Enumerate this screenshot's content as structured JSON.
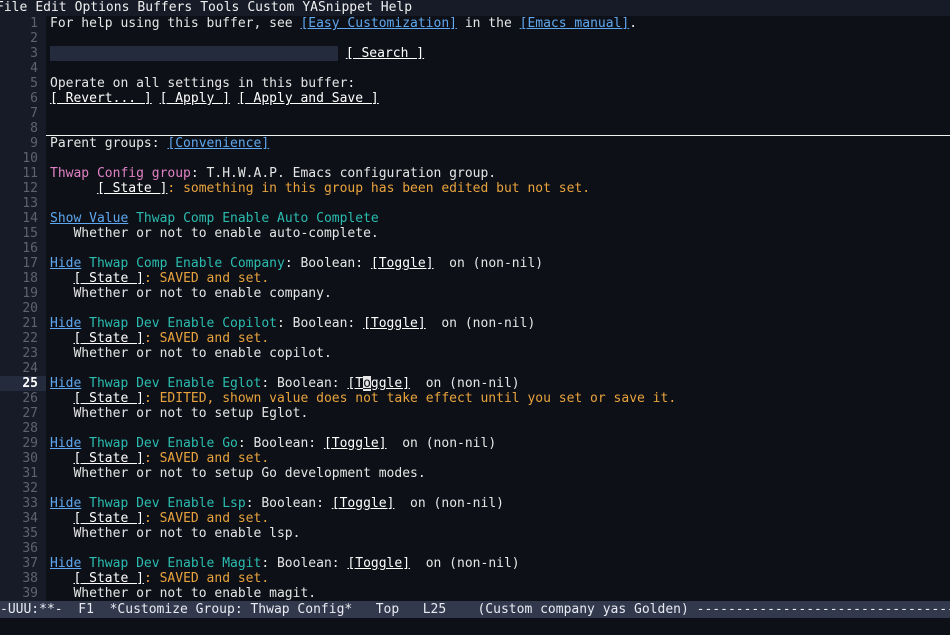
{
  "menubar": {
    "items": [
      "File",
      "Edit",
      "Options",
      "Buffers",
      "Tools",
      "Custom",
      "YASnippet",
      "Help"
    ]
  },
  "colors": {
    "background": "#0d1017",
    "gutter": "#161b27",
    "link": "#5fa8f0",
    "variable": "#2bbcb0",
    "group": "#e081c4",
    "state": "#e8a33d",
    "modeline_bg": "#33394d",
    "current_line_bg": "#242b3d"
  },
  "help_line": {
    "prefix": "For help using this buffer, see ",
    "link1": "[Easy Customization]",
    "middle": " in the ",
    "link2": "[Emacs manual]",
    "suffix": "."
  },
  "search": {
    "field_value": "",
    "field_placeholder": "",
    "button_label": "[ Search ]"
  },
  "operate": {
    "heading": "Operate on all settings in this buffer:",
    "revert_label": "[ Revert... ]",
    "apply_label": "[ Apply ]",
    "apply_and_save_label": "[ Apply and Save ]"
  },
  "parent_groups": {
    "label": "Parent groups: ",
    "link": "[Convenience]"
  },
  "group_header": {
    "name": "Thwap Config group",
    "description": ": T.H.W.A.P. Emacs configuration group.",
    "state_button": "[ State ]",
    "state_text": ": something in this group has been edited but not set."
  },
  "line_numbers": [
    1,
    2,
    3,
    4,
    5,
    6,
    7,
    8,
    9,
    10,
    11,
    12,
    13,
    14,
    15,
    16,
    17,
    18,
    19,
    20,
    21,
    22,
    23,
    24,
    25,
    26,
    27,
    28,
    29,
    30,
    31,
    32,
    33,
    34,
    35,
    36,
    37,
    38,
    39
  ],
  "current_line": 25,
  "settings": [
    {
      "toggle_link": "Show Value",
      "name": "Thwap Comp Enable Auto Complete",
      "has_type": false,
      "type_label": "",
      "toggle_label": "",
      "value_label": "",
      "state_button": "",
      "state_text": "",
      "doc": "Whether or not to enable auto-complete."
    },
    {
      "toggle_link": "Hide",
      "name": "Thwap Comp Enable Company",
      "has_type": true,
      "type_label": ": Boolean: ",
      "toggle_label": "[Toggle]",
      "value_label": "  on (non-nil)",
      "state_button": "[ State ]",
      "state_text": ": SAVED and set.",
      "doc": "Whether or not to enable company."
    },
    {
      "toggle_link": "Hide",
      "name": "Thwap Dev Enable Copilot",
      "has_type": true,
      "type_label": ": Boolean: ",
      "toggle_label": "[Toggle]",
      "value_label": "  on (non-nil)",
      "state_button": "[ State ]",
      "state_text": ": SAVED and set.",
      "doc": "Whether or not to enable copilot."
    },
    {
      "toggle_link": "Hide",
      "name": "Thwap Dev Enable Eglot",
      "has_type": true,
      "type_label": ": Boolean: ",
      "toggle_label": "[Toggle]",
      "value_label": "  on (non-nil)",
      "state_button": "[ State ]",
      "state_text": ": EDITED, shown value does not take effect until you set or save it.",
      "doc": "Whether or not to setup Eglot."
    },
    {
      "toggle_link": "Hide",
      "name": "Thwap Dev Enable Go",
      "has_type": true,
      "type_label": ": Boolean: ",
      "toggle_label": "[Toggle]",
      "value_label": "  on (non-nil)",
      "state_button": "[ State ]",
      "state_text": ": SAVED and set.",
      "doc": "Whether or not to setup Go development modes."
    },
    {
      "toggle_link": "Hide",
      "name": "Thwap Dev Enable Lsp",
      "has_type": true,
      "type_label": ": Boolean: ",
      "toggle_label": "[Toggle]",
      "value_label": "  on (non-nil)",
      "state_button": "[ State ]",
      "state_text": ": SAVED and set.",
      "doc": "Whether or not to enable lsp."
    },
    {
      "toggle_link": "Hide",
      "name": "Thwap Dev Enable Magit",
      "has_type": true,
      "type_label": ": Boolean: ",
      "toggle_label": "[Toggle]",
      "value_label": "  on (non-nil)",
      "state_button": "[ State ]",
      "state_text": ": SAVED and set.",
      "doc": "Whether or not to enable magit."
    }
  ],
  "modeline": {
    "mode_indicator": "-UUU:**-",
    "frame": "F1",
    "buffer_name": "*Customize Group: Thwap Config*",
    "position": "Top",
    "line_indicator": "L25",
    "minor_modes": "(Custom company yas Golden)",
    "filler": "------------------------------------------------------------------"
  }
}
